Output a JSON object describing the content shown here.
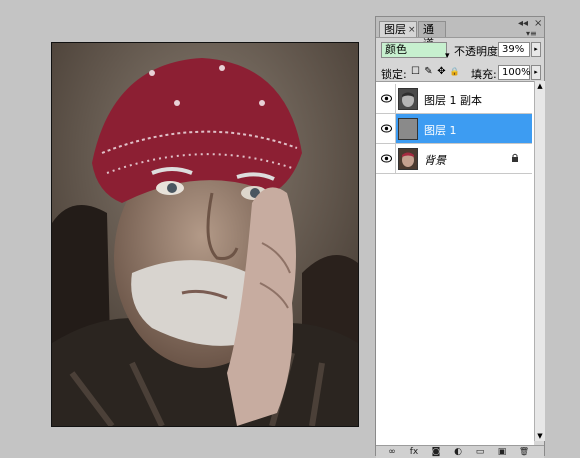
{
  "panel": {
    "tabs": [
      {
        "label": "图层",
        "close": "×"
      },
      {
        "label": "通道"
      }
    ],
    "controls": {
      "menu": "▾≡",
      "collapse": "◂◂",
      "close": "×"
    },
    "blend_mode": {
      "value": "颜色",
      "arrow": "▾"
    },
    "opacity": {
      "label": "不透明度:",
      "value": "39%"
    },
    "lock": {
      "label": "锁定:",
      "icons": [
        "☐",
        "✎",
        "✥",
        "🔒"
      ]
    },
    "fill": {
      "label": "填充:",
      "value": "100%"
    },
    "stepper_arrow": "▸",
    "layers": [
      {
        "name": "图层 1 副本",
        "selected": false,
        "italic": false
      },
      {
        "name": "图层 1",
        "selected": true,
        "italic": false
      },
      {
        "name": "背景",
        "selected": false,
        "italic": true,
        "locked": true
      }
    ],
    "scroll": {
      "up": "▲",
      "down": "▼"
    },
    "bottom_icons": [
      "link-icon",
      "fx-icon",
      "mask-icon",
      "adjustment-icon",
      "group-icon",
      "new-layer-icon",
      "trash-icon"
    ],
    "bottom_glyphs": [
      "∞",
      "fx",
      "◙",
      "◐",
      "▭",
      "▣",
      "🗑"
    ]
  },
  "colors": {
    "selection": "#3d9cf2",
    "blend_field": "#c7f0cf",
    "bandana": "#8c1f33"
  }
}
